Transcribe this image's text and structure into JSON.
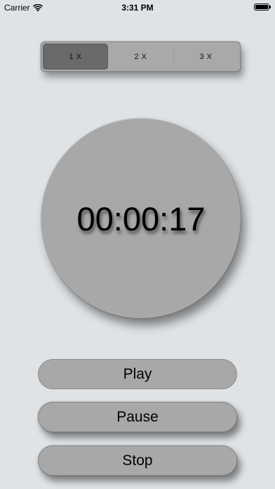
{
  "status_bar": {
    "carrier": "Carrier",
    "time": "3:31 PM",
    "battery_level": 1.0
  },
  "speed_selector": {
    "selected_index": 0,
    "options": [
      "1 X",
      "2 X",
      "3 X"
    ]
  },
  "timer": {
    "display": "00:00:17"
  },
  "controls": {
    "play_label": "Play",
    "pause_label": "Pause",
    "stop_label": "Stop"
  },
  "colors": {
    "background": "#dfe3e6",
    "control_fill": "#a8a8a8",
    "selected_segment": "#6a6a6a"
  }
}
